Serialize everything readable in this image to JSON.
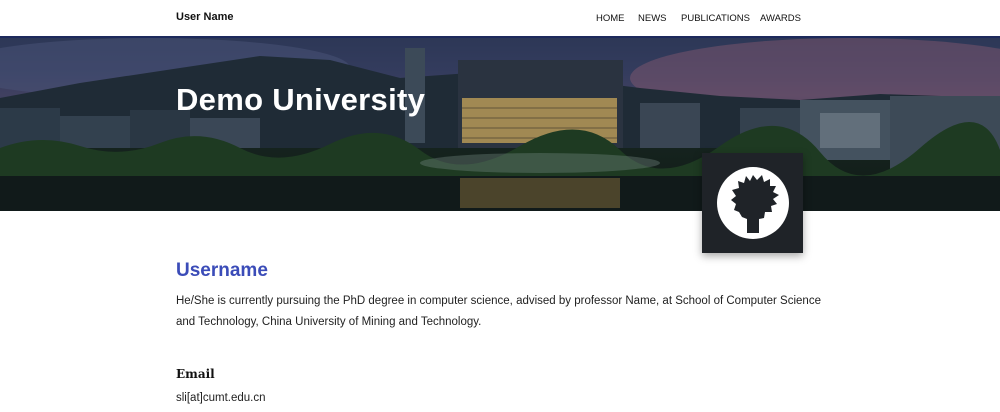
{
  "navbar": {
    "brand": "User Name",
    "links": [
      {
        "label": "HOME"
      },
      {
        "label": "NEWS"
      },
      {
        "label": "PUBLICATIONS"
      },
      {
        "label": "AWARDS"
      }
    ]
  },
  "hero": {
    "title": "Demo University"
  },
  "profile": {
    "name": "Username",
    "bio": "He/She is currently pursuing the PhD degree in computer science, advised by professor Name, at School of Computer Science and Technology, China University of Mining and Technology.",
    "email_heading": "Email",
    "email_value": "sli[at]cumt.edu.cn"
  },
  "colors": {
    "accent": "#3b4cb8",
    "navbar_border": "#1d2a5c",
    "avatar_bg": "#1f2328"
  },
  "icons": {
    "avatar": "person-silhouette-icon"
  }
}
